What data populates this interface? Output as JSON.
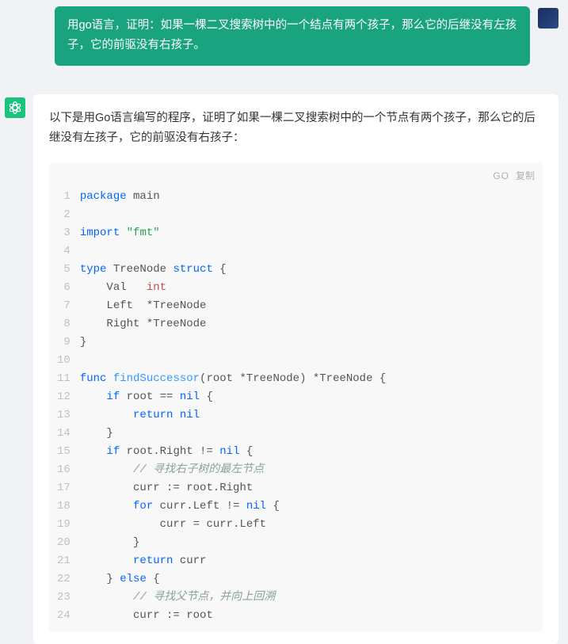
{
  "user": {
    "message": "用go语言，证明：如果一棵二叉搜索树中的一个结点有两个孩子，那么它的后继没有左孩子，它的前驱没有右孩子。"
  },
  "assistant": {
    "intro": "以下是用Go语言编写的程序，证明了如果一棵二叉搜索树中的一个节点有两个孩子，那么它的后继没有左孩子，它的前驱没有右孩子：",
    "code_lang": "GO",
    "copy_label": "复制",
    "code": [
      {
        "n": 1,
        "tokens": [
          {
            "t": "package",
            "c": "kw"
          },
          {
            "t": " main",
            "c": "pln"
          }
        ]
      },
      {
        "n": 2,
        "tokens": []
      },
      {
        "n": 3,
        "tokens": [
          {
            "t": "import",
            "c": "kw"
          },
          {
            "t": " ",
            "c": "pln"
          },
          {
            "t": "\"fmt\"",
            "c": "str"
          }
        ]
      },
      {
        "n": 4,
        "tokens": []
      },
      {
        "n": 5,
        "tokens": [
          {
            "t": "type",
            "c": "kw"
          },
          {
            "t": " TreeNode ",
            "c": "pln"
          },
          {
            "t": "struct",
            "c": "kw"
          },
          {
            "t": " {",
            "c": "pln"
          }
        ]
      },
      {
        "n": 6,
        "tokens": [
          {
            "t": "    Val   ",
            "c": "pln"
          },
          {
            "t": "int",
            "c": "typ"
          }
        ]
      },
      {
        "n": 7,
        "tokens": [
          {
            "t": "    Left  *TreeNode",
            "c": "pln"
          }
        ]
      },
      {
        "n": 8,
        "tokens": [
          {
            "t": "    Right *TreeNode",
            "c": "pln"
          }
        ]
      },
      {
        "n": 9,
        "tokens": [
          {
            "t": "}",
            "c": "pln"
          }
        ]
      },
      {
        "n": 10,
        "tokens": []
      },
      {
        "n": 11,
        "tokens": [
          {
            "t": "func",
            "c": "kw"
          },
          {
            "t": " ",
            "c": "pln"
          },
          {
            "t": "findSuccessor",
            "c": "fn"
          },
          {
            "t": "(root *TreeNode) *TreeNode {",
            "c": "pln"
          }
        ]
      },
      {
        "n": 12,
        "tokens": [
          {
            "t": "    ",
            "c": "pln"
          },
          {
            "t": "if",
            "c": "kw"
          },
          {
            "t": " root == ",
            "c": "pln"
          },
          {
            "t": "nil",
            "c": "kw"
          },
          {
            "t": " {",
            "c": "pln"
          }
        ]
      },
      {
        "n": 13,
        "tokens": [
          {
            "t": "        ",
            "c": "pln"
          },
          {
            "t": "return",
            "c": "kw"
          },
          {
            "t": " ",
            "c": "pln"
          },
          {
            "t": "nil",
            "c": "kw"
          }
        ]
      },
      {
        "n": 14,
        "tokens": [
          {
            "t": "    }",
            "c": "pln"
          }
        ]
      },
      {
        "n": 15,
        "tokens": [
          {
            "t": "    ",
            "c": "pln"
          },
          {
            "t": "if",
            "c": "kw"
          },
          {
            "t": " root.Right != ",
            "c": "pln"
          },
          {
            "t": "nil",
            "c": "kw"
          },
          {
            "t": " {",
            "c": "pln"
          }
        ]
      },
      {
        "n": 16,
        "tokens": [
          {
            "t": "        ",
            "c": "pln"
          },
          {
            "t": "// 寻找右子树的最左节点",
            "c": "cmt"
          }
        ]
      },
      {
        "n": 17,
        "tokens": [
          {
            "t": "        curr := root.Right",
            "c": "pln"
          }
        ]
      },
      {
        "n": 18,
        "tokens": [
          {
            "t": "        ",
            "c": "pln"
          },
          {
            "t": "for",
            "c": "kw"
          },
          {
            "t": " curr.Left != ",
            "c": "pln"
          },
          {
            "t": "nil",
            "c": "kw"
          },
          {
            "t": " {",
            "c": "pln"
          }
        ]
      },
      {
        "n": 19,
        "tokens": [
          {
            "t": "            curr = curr.Left",
            "c": "pln"
          }
        ]
      },
      {
        "n": 20,
        "tokens": [
          {
            "t": "        }",
            "c": "pln"
          }
        ]
      },
      {
        "n": 21,
        "tokens": [
          {
            "t": "        ",
            "c": "pln"
          },
          {
            "t": "return",
            "c": "kw"
          },
          {
            "t": " curr",
            "c": "pln"
          }
        ]
      },
      {
        "n": 22,
        "tokens": [
          {
            "t": "    } ",
            "c": "pln"
          },
          {
            "t": "else",
            "c": "kw"
          },
          {
            "t": " {",
            "c": "pln"
          }
        ]
      },
      {
        "n": 23,
        "tokens": [
          {
            "t": "        ",
            "c": "pln"
          },
          {
            "t": "// 寻找父节点，并向上回溯",
            "c": "cmt"
          }
        ]
      },
      {
        "n": 24,
        "tokens": [
          {
            "t": "        curr := root",
            "c": "pln"
          }
        ]
      }
    ]
  }
}
